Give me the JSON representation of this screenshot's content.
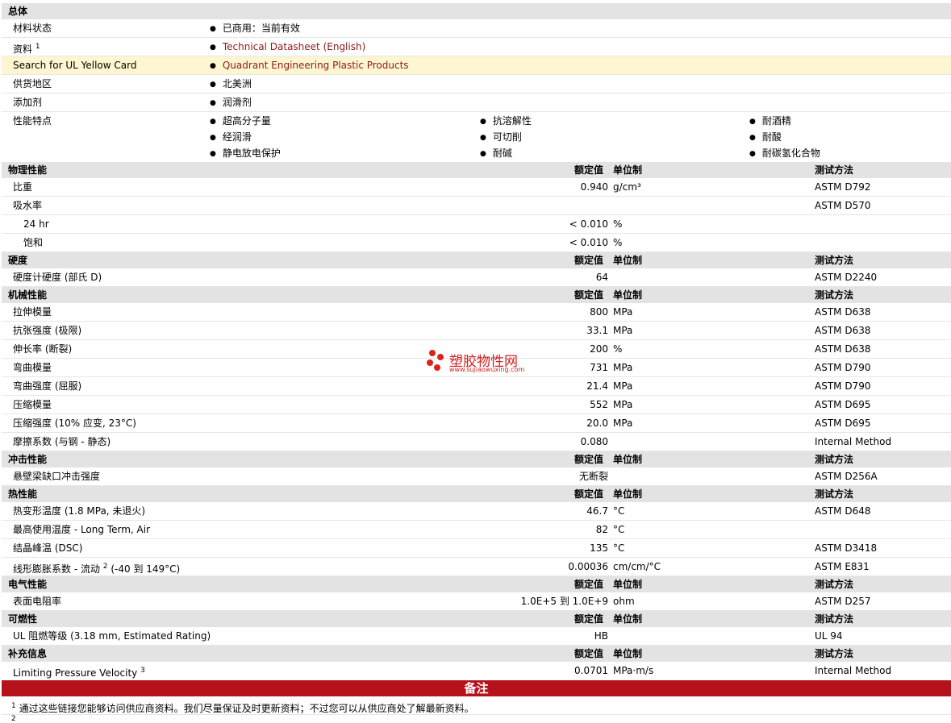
{
  "general": {
    "title": "总体",
    "status_label": "材料状态",
    "status_value": "已商用：当前有效",
    "docs_label": "资料",
    "docs_sup": "1",
    "docs_value": "Technical Datasheet (English)",
    "ul_label": "Search for UL Yellow Card",
    "ul_value": "Quadrant Engineering Plastic Products",
    "supply_label": "供货地区",
    "supply_value": "北美洲",
    "additive_label": "添加剂",
    "additive_value": "润滑剂",
    "features_label": "性能特点",
    "features": [
      "超高分子量",
      "抗溶解性",
      "耐酒精",
      "经润滑",
      "可切削",
      "耐酸",
      "静电放电保护",
      "耐碱",
      "耐碳氢化合物"
    ]
  },
  "headers": {
    "value": "额定值",
    "unit": "单位制",
    "method": "测试方法"
  },
  "sections": {
    "physical": {
      "title": "物理性能",
      "rows": [
        {
          "label": "比重",
          "value": "0.940",
          "unit": "g/cm³",
          "method": "ASTM D792"
        },
        {
          "label": "吸水率",
          "value": "",
          "unit": "",
          "method": "ASTM D570"
        },
        {
          "label": "24 hr",
          "value": "< 0.010",
          "unit": "%",
          "method": ""
        },
        {
          "label": "饱和",
          "value": "< 0.010",
          "unit": "%",
          "method": ""
        }
      ]
    },
    "hardness": {
      "title": "硬度",
      "rows": [
        {
          "label": "硬度计硬度 (部氏 D)",
          "value": "64",
          "unit": "",
          "method": "ASTM D2240"
        }
      ]
    },
    "mechanical": {
      "title": "机械性能",
      "rows": [
        {
          "label": "拉伸模量",
          "value": "800",
          "unit": "MPa",
          "method": "ASTM D638"
        },
        {
          "label": "抗张强度 (极限)",
          "value": "33.1",
          "unit": "MPa",
          "method": "ASTM D638"
        },
        {
          "label": "伸长率 (断裂)",
          "value": "200",
          "unit": "%",
          "method": "ASTM D638"
        },
        {
          "label": "弯曲模量",
          "value": "731",
          "unit": "MPa",
          "method": "ASTM D790"
        },
        {
          "label": "弯曲强度 (屈服)",
          "value": "21.4",
          "unit": "MPa",
          "method": "ASTM D790"
        },
        {
          "label": "压缩模量",
          "value": "552",
          "unit": "MPa",
          "method": "ASTM D695"
        },
        {
          "label": "压缩强度 (10% 应变, 23°C)",
          "value": "20.0",
          "unit": "MPa",
          "method": "ASTM D695"
        },
        {
          "label": "摩擦系数 (与钢 - 静态)",
          "value": "0.080",
          "unit": "",
          "method": "Internal Method"
        }
      ]
    },
    "impact": {
      "title": "冲击性能",
      "rows": [
        {
          "label": "悬壁梁缺口冲击强度",
          "value": "无断裂",
          "unit": "",
          "method": "ASTM D256A"
        }
      ]
    },
    "thermal": {
      "title": "热性能",
      "rows": [
        {
          "label": "热变形温度 (1.8 MPa, 未退火)",
          "value": "46.7",
          "unit": "°C",
          "method": "ASTM D648"
        },
        {
          "label": "最高使用温度 - Long Term, Air",
          "value": "82",
          "unit": "°C",
          "method": ""
        },
        {
          "label": "结晶峰温 (DSC)",
          "value": "135",
          "unit": "°C",
          "method": "ASTM D3418"
        },
        {
          "label": "线形膨胀系数 - 流动",
          "sup": "2",
          "label_tail": "(-40 到 149°C)",
          "value": "0.00036",
          "unit": "cm/cm/°C",
          "method": "ASTM E831"
        }
      ]
    },
    "electrical": {
      "title": "电气性能",
      "rows": [
        {
          "label": "表面电阻率",
          "value": "1.0E+5 到 1.0E+9",
          "unit": "ohm",
          "method": "ASTM D257"
        }
      ]
    },
    "flammability": {
      "title": "可燃性",
      "rows": [
        {
          "label": "UL 阻燃等级 (3.18 mm, Estimated Rating)",
          "value": "HB",
          "unit": "",
          "method": "UL 94"
        }
      ]
    },
    "supplemental": {
      "title": "补充信息",
      "rows": [
        {
          "label": "Limiting Pressure Velocity",
          "sup": "3",
          "value": "0.0701",
          "unit": "MPa·m/s",
          "method": "Internal Method"
        }
      ]
    }
  },
  "notes": {
    "title": "备注",
    "note1_sup": "1",
    "note1": "通过这些链接您能够访问供应商资料。我们尽量保证及时更新资料；不过您可以从供应商处了解最新资料。",
    "note2_sup": "2"
  },
  "watermark": {
    "name": "塑胶物性网",
    "url": "www.sujiaowuxing.com"
  }
}
